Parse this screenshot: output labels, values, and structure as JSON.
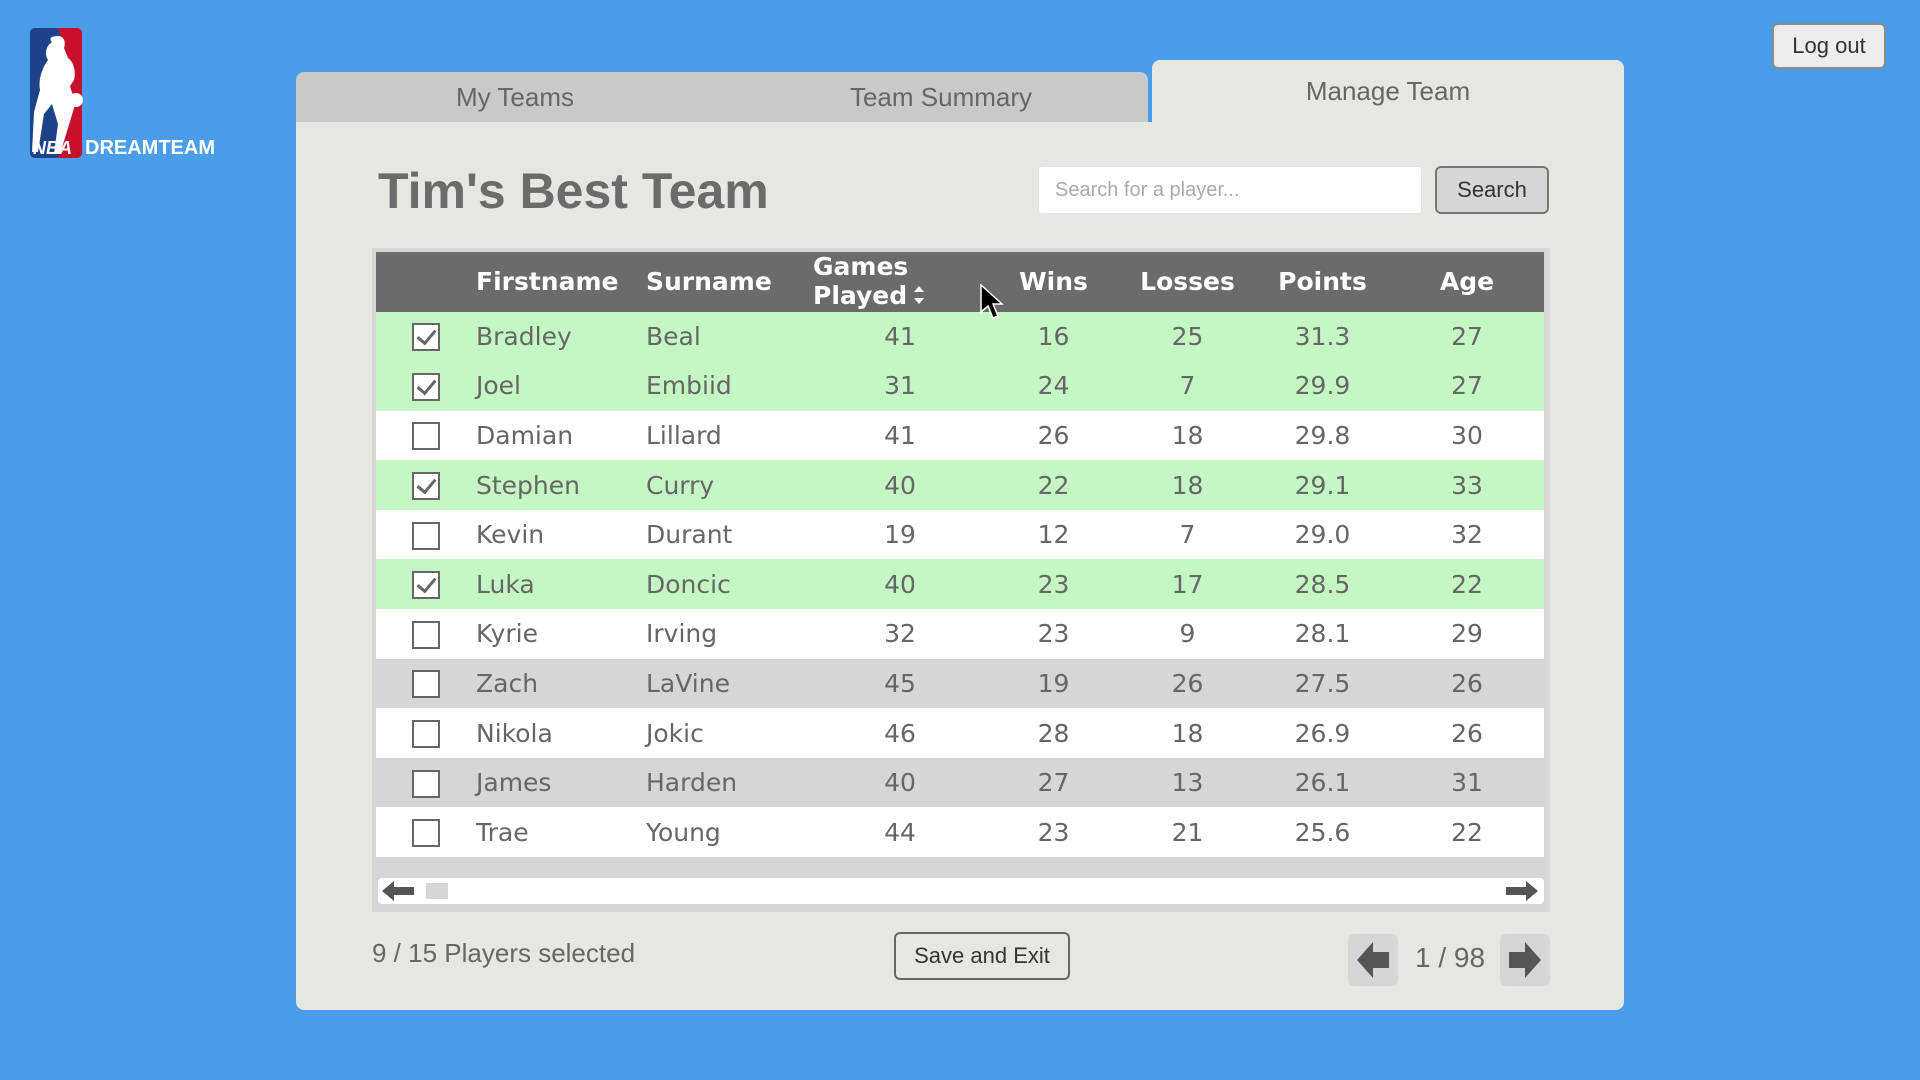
{
  "logo": {
    "text_nba": "NBA",
    "text_dreamteam": "DREAMTEAM"
  },
  "header": {
    "logout_label": "Log out"
  },
  "tabs": [
    {
      "label": "My Teams",
      "active": false
    },
    {
      "label": "Team Summary",
      "active": false
    },
    {
      "label": "Manage Team",
      "active": true
    }
  ],
  "team": {
    "title": "Tim's Best Team"
  },
  "search": {
    "placeholder": "Search for a player...",
    "value": "",
    "button_label": "Search"
  },
  "table": {
    "columns": [
      "Firstname",
      "Surname",
      "Games Played",
      "Wins",
      "Losses",
      "Points",
      "Age"
    ],
    "sorted_column": "Games Played",
    "rows": [
      {
        "selected": true,
        "first": "Bradley",
        "last": "Beal",
        "gp": "41",
        "w": "16",
        "l": "25",
        "p": "31.3",
        "age": "27"
      },
      {
        "selected": true,
        "first": "Joel",
        "last": "Embiid",
        "gp": "31",
        "w": "24",
        "l": "7",
        "p": "29.9",
        "age": "27"
      },
      {
        "selected": false,
        "first": "Damian",
        "last": "Lillard",
        "gp": "41",
        "w": "26",
        "l": "18",
        "p": "29.8",
        "age": "30"
      },
      {
        "selected": true,
        "first": "Stephen",
        "last": "Curry",
        "gp": "40",
        "w": "22",
        "l": "18",
        "p": "29.1",
        "age": "33"
      },
      {
        "selected": false,
        "first": "Kevin",
        "last": "Durant",
        "gp": "19",
        "w": "12",
        "l": "7",
        "p": "29.0",
        "age": "32"
      },
      {
        "selected": true,
        "first": "Luka",
        "last": "Doncic",
        "gp": "40",
        "w": "23",
        "l": "17",
        "p": "28.5",
        "age": "22"
      },
      {
        "selected": false,
        "first": "Kyrie",
        "last": "Irving",
        "gp": "32",
        "w": "23",
        "l": "9",
        "p": "28.1",
        "age": "29"
      },
      {
        "selected": false,
        "first": "Zach",
        "last": "LaVine",
        "gp": "45",
        "w": "19",
        "l": "26",
        "p": "27.5",
        "age": "26"
      },
      {
        "selected": false,
        "first": "Nikola",
        "last": "Jokic",
        "gp": "46",
        "w": "28",
        "l": "18",
        "p": "26.9",
        "age": "26"
      },
      {
        "selected": false,
        "first": "James",
        "last": "Harden",
        "gp": "40",
        "w": "27",
        "l": "13",
        "p": "26.1",
        "age": "31"
      },
      {
        "selected": false,
        "first": "Trae",
        "last": "Young",
        "gp": "44",
        "w": "23",
        "l": "21",
        "p": "25.6",
        "age": "22"
      }
    ]
  },
  "footer": {
    "selected_text": "9 / 15 Players selected",
    "save_label": "Save and Exit",
    "page_text": "1 / 98"
  },
  "colors": {
    "background": "#4a9de8",
    "panel": "#e6e6e2",
    "header_row": "#6b6b6b",
    "selected_row": "#c5f7c5",
    "striped_row": "#d6d6d6"
  }
}
